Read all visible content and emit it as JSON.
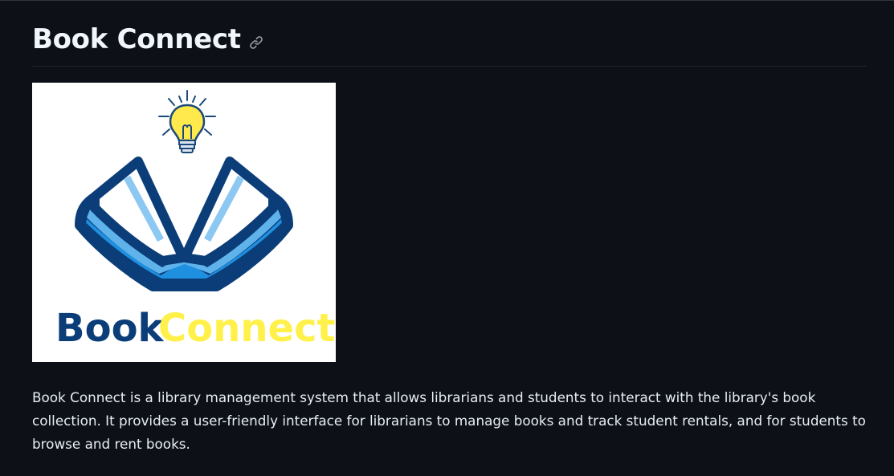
{
  "readme": {
    "title": "Book Connect",
    "anchor_icon": "link-icon",
    "logo": {
      "wordmark_part1": "Book",
      "wordmark_part2": "Connect",
      "colors": {
        "navy": "#0b3d78",
        "blue": "#1f8fe0",
        "light_blue": "#8cc8f2",
        "yellow": "#fff14a",
        "bulb_yellow": "#ffe94d"
      }
    },
    "description": "Book Connect is a library management system that allows librarians and students to interact with the library's book collection. It provides a user-friendly interface for librarians to manage books and track student rentals, and for students to browse and rent books."
  }
}
